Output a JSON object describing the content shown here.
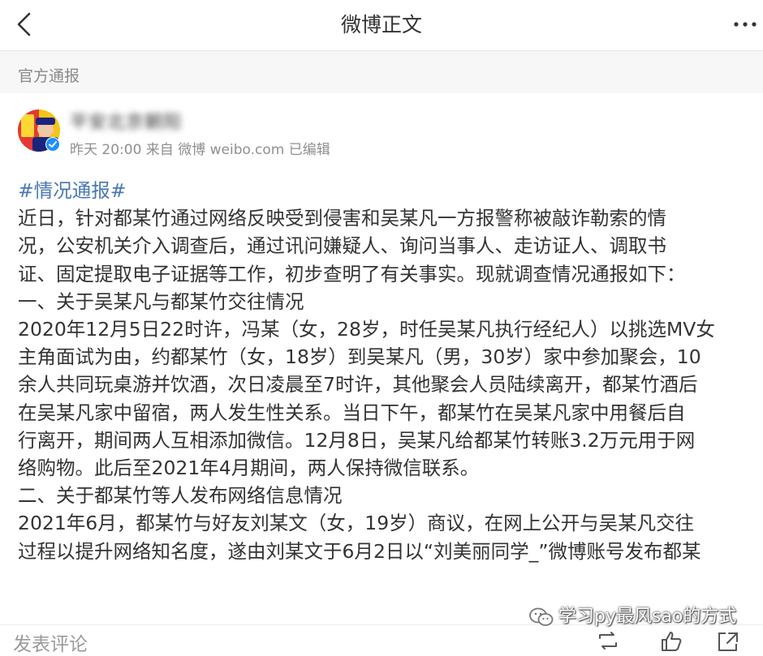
{
  "navbar": {
    "back_icon": "chevron-left-icon",
    "title": "微博正文",
    "more_icon": "more-horizontal-icon"
  },
  "category": {
    "label": "官方通报"
  },
  "author": {
    "name": "平安北京朝阳",
    "verified_icon": "verified-badge-icon",
    "meta": "昨天 20:00 来自 微博 weibo.com 已编辑"
  },
  "post": {
    "hashtag": "#情况通报#",
    "lines": [
      "近日，针对都某竹通过网络反映受到侵害和吴某凡一方报警称被敲诈勒索的情",
      "况，公安机关介入调查后，通过讯问嫌疑人、询问当事人、走访证人、调取书",
      "证、固定提取电子证据等工作，初步查明了有关事实。现就调查情况通报如下：",
      "一、关于吴某凡与都某竹交往情况",
      "2020年12月5日22时许，冯某（女，28岁，时任吴某凡执行经纪人）以挑选MV女",
      "主角面试为由，约都某竹（女，18岁）到吴某凡（男，30岁）家中参加聚会，10",
      "余人共同玩桌游并饮酒，次日凌晨至7时许，其他聚会人员陆续离开，都某竹酒后",
      "在吴某凡家中留宿，两人发生性关系。当日下午，都某竹在吴某凡家中用餐后自",
      "行离开，期间两人互相添加微信。12月8日，吴某凡给都某竹转账3.2万元用于网",
      "络购物。此后至2021年4月期间，两人保持微信联系。",
      "二、关于都某竹等人发布网络信息情况",
      "2021年6月，都某竹与好友刘某文（女，19岁）商议，在网上公开与吴某凡交往",
      "过程以提升网络知名度，遂由刘某文于6月2日以“刘美丽同学_”微博账号发布都某"
    ]
  },
  "watermark": {
    "icon": "wechat-icon",
    "text": "学习py最风sao的方式"
  },
  "bottombar": {
    "comment_placeholder": "发表评论",
    "repost_icon": "repost-icon",
    "like_icon": "thumbs-up-icon",
    "share_icon": "share-icon"
  },
  "colors": {
    "hashtag": "#4a77b3",
    "verified": "#1e90ff",
    "category_bg": "#f7f7f7"
  }
}
